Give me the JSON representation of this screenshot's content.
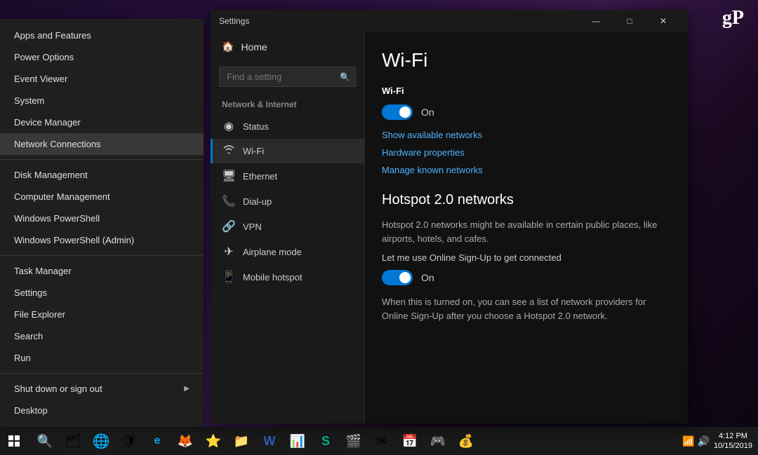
{
  "desktop": {
    "gp_logo": "gP"
  },
  "context_menu": {
    "items": [
      {
        "label": "Apps and Features",
        "active": false,
        "has_arrow": false
      },
      {
        "label": "Power Options",
        "active": false,
        "has_arrow": false
      },
      {
        "label": "Event Viewer",
        "active": false,
        "has_arrow": false
      },
      {
        "label": "System",
        "active": false,
        "has_arrow": false
      },
      {
        "label": "Device Manager",
        "active": false,
        "has_arrow": false
      },
      {
        "label": "Network Connections",
        "active": true,
        "has_arrow": false
      }
    ],
    "items2": [
      {
        "label": "Disk Management",
        "active": false,
        "has_arrow": false
      },
      {
        "label": "Computer Management",
        "active": false,
        "has_arrow": false
      },
      {
        "label": "Windows PowerShell",
        "active": false,
        "has_arrow": false
      },
      {
        "label": "Windows PowerShell (Admin)",
        "active": false,
        "has_arrow": false
      }
    ],
    "items3": [
      {
        "label": "Task Manager",
        "active": false,
        "has_arrow": false
      },
      {
        "label": "Settings",
        "active": false,
        "has_arrow": false
      },
      {
        "label": "File Explorer",
        "active": false,
        "has_arrow": false
      },
      {
        "label": "Search",
        "active": false,
        "has_arrow": false
      },
      {
        "label": "Run",
        "active": false,
        "has_arrow": false
      }
    ],
    "items4": [
      {
        "label": "Shut down or sign out",
        "active": false,
        "has_arrow": true
      },
      {
        "label": "Desktop",
        "active": false,
        "has_arrow": false
      }
    ]
  },
  "settings": {
    "title": "Settings",
    "titlebar_controls": {
      "minimize": "—",
      "maximize": "□",
      "close": "✕"
    },
    "home_label": "Home",
    "search_placeholder": "Find a setting",
    "section_label": "Network & Internet",
    "nav_items": [
      {
        "icon": "📶",
        "label": "Status"
      },
      {
        "icon": "📡",
        "label": "Wi-Fi",
        "active": true
      },
      {
        "icon": "🖥",
        "label": "Ethernet"
      },
      {
        "icon": "📞",
        "label": "Dial-up"
      },
      {
        "icon": "🔗",
        "label": "VPN"
      },
      {
        "icon": "✈",
        "label": "Airplane mode"
      },
      {
        "icon": "📱",
        "label": "Mobile hotspot"
      }
    ],
    "main": {
      "page_title": "Wi-Fi",
      "wifi_section": {
        "header": "Wi-Fi",
        "toggle_label": "On",
        "links": [
          "Show available networks",
          "Hardware properties",
          "Manage known networks"
        ]
      },
      "hotspot_section": {
        "header": "Hotspot 2.0 networks",
        "desc": "Hotspot 2.0 networks might be available in certain public places, like airports, hotels, and cafes.",
        "sub_label": "Let me use Online Sign-Up to get connected",
        "toggle_label": "On",
        "note": "When this is turned on, you can see a list of network providers for Online Sign-Up after you choose a Hotspot 2.0 network."
      }
    }
  },
  "taskbar": {
    "start_icon": "⊞",
    "icons": [
      "🔍",
      "🗂",
      "🌐",
      "🛡",
      "e",
      "🦊",
      "⭐",
      "📁",
      "W",
      "📊",
      "S",
      "🎬",
      "✉",
      "📅",
      "🎮",
      "💰"
    ],
    "time": "4:12 PM",
    "date": "10/15/2019"
  }
}
